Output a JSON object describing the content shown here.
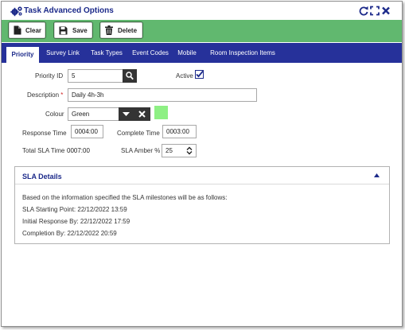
{
  "window": {
    "title": "Task Advanced Options",
    "icons": [
      "gears-icon",
      "refresh-icon",
      "expand-icon",
      "close-icon"
    ]
  },
  "toolbar": {
    "clear_label": "Clear",
    "save_label": "Save",
    "delete_label": "Delete"
  },
  "tabs": [
    {
      "label": "Priority",
      "active": true
    },
    {
      "label": "Survey Link"
    },
    {
      "label": "Task Types"
    },
    {
      "label": "Event Codes"
    },
    {
      "label": "Mobile"
    },
    {
      "label": "Room Inspection Items"
    }
  ],
  "form": {
    "priority_id_label": "Priority ID",
    "priority_id_value": "5",
    "active_label": "Active",
    "active_checked": true,
    "description_label": "Description",
    "required_marker": "*",
    "description_value": "Daily 4h-3h",
    "colour_label": "Colour",
    "colour_value": "Green",
    "colour_swatch": "#8ef084",
    "response_time_label": "Response Time",
    "response_time_value": "0004:00",
    "complete_time_label": "Complete Time",
    "complete_time_value": "0003:00",
    "total_sla_label": "Total SLA Time",
    "total_sla_value": "0007:00",
    "sla_amber_label": "SLA Amber %",
    "sla_amber_value": "25"
  },
  "sla": {
    "title": "SLA Details",
    "intro": "Based on the information specified the SLA milestones will be as follows:",
    "starting_point": "SLA Starting Point: 22/12/2022 13:59",
    "initial_response": "Initial Response By: 22/12/2022 17:59",
    "completion": "Completion By: 22/12/2022 20:59"
  },
  "colors": {
    "title_text": "#1c2a8a",
    "toolbar_bg": "#61b86f",
    "tab_bar_bg": "#26319a",
    "icon_dark": "#343434"
  }
}
